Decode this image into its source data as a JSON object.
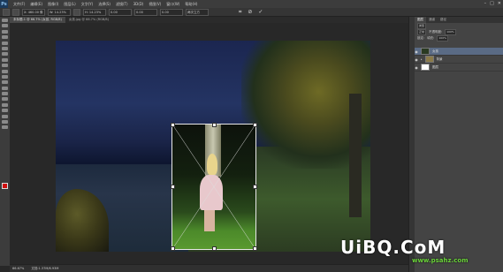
{
  "app": {
    "logo": "Ps",
    "menu": [
      "文件(F)",
      "编辑(E)",
      "图像(I)",
      "图层(L)",
      "文字(Y)",
      "选择(S)",
      "滤镜(T)",
      "3D(D)",
      "视图(V)",
      "窗口(W)",
      "帮助(H)"
    ],
    "window_controls": [
      "–",
      "□",
      "✕"
    ]
  },
  "options": {
    "x": "X: 460.00 像",
    "w": "W: 14.23%",
    "h": "H: 14.23%",
    "angle": "0.00",
    "h_skew": "0.00",
    "v_skew": "0.00",
    "interp": "两次立方"
  },
  "commit": {
    "warp": "⌗",
    "cancel": "⊘",
    "confirm": "✓"
  },
  "tabs": [
    {
      "label": "未标题-1 @ 66.7% (女孩, RGB/8)"
    },
    {
      "label": "女孩.jpg @ 66.7% (RGB/8)"
    }
  ],
  "status": {
    "zoom": "66.67%",
    "doc": "文档:1.37M/6.93M"
  },
  "panel": {
    "tabs": [
      "图层",
      "通道",
      "路径"
    ],
    "kind": "类型",
    "blend": "正常",
    "opacity_label": "不透明度:",
    "opacity": "100%",
    "lock_label": "锁定:",
    "fill_label": "填充:",
    "fill": "100%",
    "layers": [
      {
        "name": "女孩",
        "type": "layer",
        "selected": true
      },
      {
        "name": "背景",
        "type": "group",
        "selected": false
      },
      {
        "name": "图层",
        "type": "layer",
        "selected": false
      }
    ]
  },
  "watermark": {
    "main": "UiBQ.CoM",
    "url": "www.psahz.com"
  }
}
